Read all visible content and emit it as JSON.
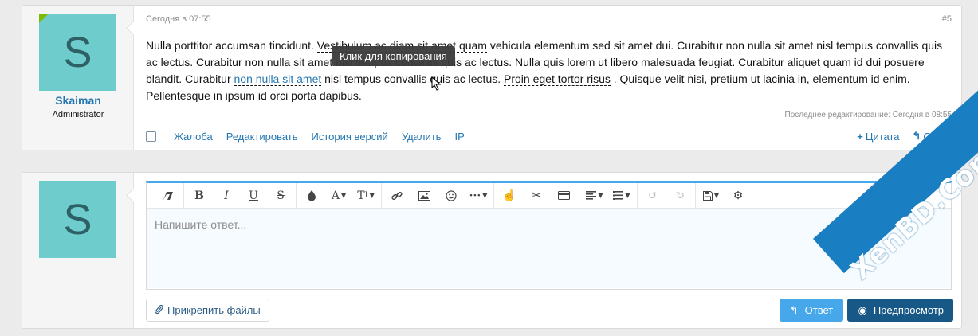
{
  "post": {
    "avatar_letter": "S",
    "username": "Skaiman",
    "user_title": "Administrator",
    "date": "Сегодня в 07:55",
    "post_number": "#5",
    "message": {
      "seg1": "Nulla porttitor accumsan tincidunt. ",
      "seg2": "Vestibulum ac diam sit amet quam",
      "seg3": " vehicula elementum sed sit amet dui. Curabitur non nulla sit amet nisl tempus convallis quis ac lectus. Curabitur non nulla sit amet nisl tempus convallis quis ac lectus. Nulla quis lorem ut libero malesuada feugiat. Curabitur aliquet quam id dui posuere blandit. Curabitur ",
      "seg4": "non nulla sit amet",
      "seg5": " nisl tempus convallis quis ac lectus. ",
      "seg6": "Proin eget tortor risus",
      "seg7": " . Quisque velit nisi, pretium ut lacinia in, elementum id enim. Pellentesque in ipsum id orci porta dapibus."
    },
    "tooltip": "Клик для копирования",
    "edit_note": "Последнее редактирование: Сегодня в 08:55",
    "actions": [
      "Жалоба",
      "Редактировать",
      "История версий",
      "Удалить",
      "IP"
    ],
    "quote_label": "Цитата",
    "reply_label": "Ответ"
  },
  "reply": {
    "avatar_letter": "S",
    "placeholder": "Напишите ответ...",
    "attach_label": "Прикрепить файлы",
    "submit_label": "Ответ",
    "preview_label": "Предпросмотр"
  },
  "watermark": "XenBD.Com",
  "colors": {
    "accent": "#47a7eb",
    "link": "#2577b1",
    "avatar_bg": "#6ecdcc",
    "online": "#7fb900",
    "preview_bg": "#185886"
  }
}
